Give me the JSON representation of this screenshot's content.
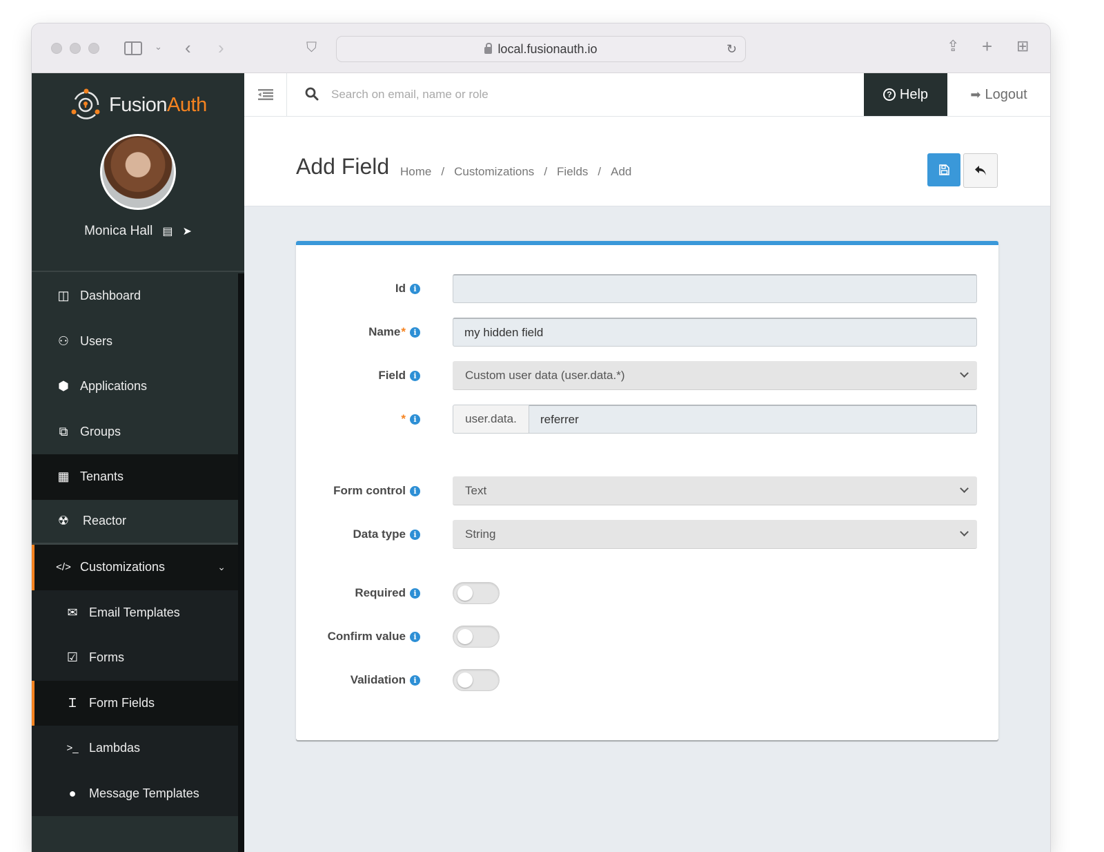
{
  "browser": {
    "url": "local.fusionauth.io",
    "icons": [
      "close-dot",
      "minimize-dot",
      "zoom-dot",
      "sidebar-toggle-icon",
      "chevron-down-icon",
      "back-icon",
      "forward-icon",
      "shield-icon",
      "lock-icon",
      "reload-icon",
      "share-icon",
      "new-tab-icon",
      "tab-overview-icon"
    ]
  },
  "brand": {
    "name_part1": "Fusion",
    "name_part2": "Auth",
    "accent_color": "#f58320"
  },
  "user": {
    "name": "Monica Hall"
  },
  "sidebar": {
    "items": [
      {
        "label": "Dashboard",
        "icon": "dashboard-icon",
        "glyph": "◫"
      },
      {
        "label": "Users",
        "icon": "users-icon",
        "glyph": "👥"
      },
      {
        "label": "Applications",
        "icon": "cube-icon",
        "glyph": "⬢"
      },
      {
        "label": "Groups",
        "icon": "groups-icon",
        "glyph": "⧉"
      },
      {
        "label": "Tenants",
        "icon": "building-icon",
        "glyph": "▦"
      },
      {
        "label": "Reactor",
        "icon": "reactor-icon",
        "glyph": "☢"
      },
      {
        "label": "Customizations",
        "icon": "code-icon",
        "glyph": "</>"
      }
    ],
    "sub_items": [
      {
        "label": "Email Templates",
        "icon": "envelope-icon",
        "glyph": "✉"
      },
      {
        "label": "Forms",
        "icon": "checkbox-icon",
        "glyph": "☑"
      },
      {
        "label": "Form Fields",
        "icon": "text-cursor-icon",
        "glyph": "I"
      },
      {
        "label": "Lambdas",
        "icon": "terminal-icon",
        "glyph": ">_"
      },
      {
        "label": "Message Templates",
        "icon": "comment-icon",
        "glyph": "💬"
      }
    ]
  },
  "topbar": {
    "search_placeholder": "Search on email, name or role",
    "help_label": "Help",
    "logout_label": "Logout"
  },
  "header": {
    "title": "Add Field",
    "breadcrumb": [
      "Home",
      "Customizations",
      "Fields",
      "Add"
    ],
    "primary_color": "#3a98d9"
  },
  "form": {
    "id": {
      "label": "Id",
      "value": ""
    },
    "name": {
      "label": "Name",
      "value": "my hidden field"
    },
    "field": {
      "label": "Field",
      "selected": "Custom user data (user.data.*)"
    },
    "key": {
      "label": "",
      "prefix": "user.data.",
      "value": "referrer"
    },
    "form_control": {
      "label": "Form control",
      "selected": "Text"
    },
    "data_type": {
      "label": "Data type",
      "selected": "String"
    },
    "required": {
      "label": "Required",
      "on": false
    },
    "confirm_value": {
      "label": "Confirm value",
      "on": false
    },
    "validation": {
      "label": "Validation",
      "on": false
    }
  }
}
